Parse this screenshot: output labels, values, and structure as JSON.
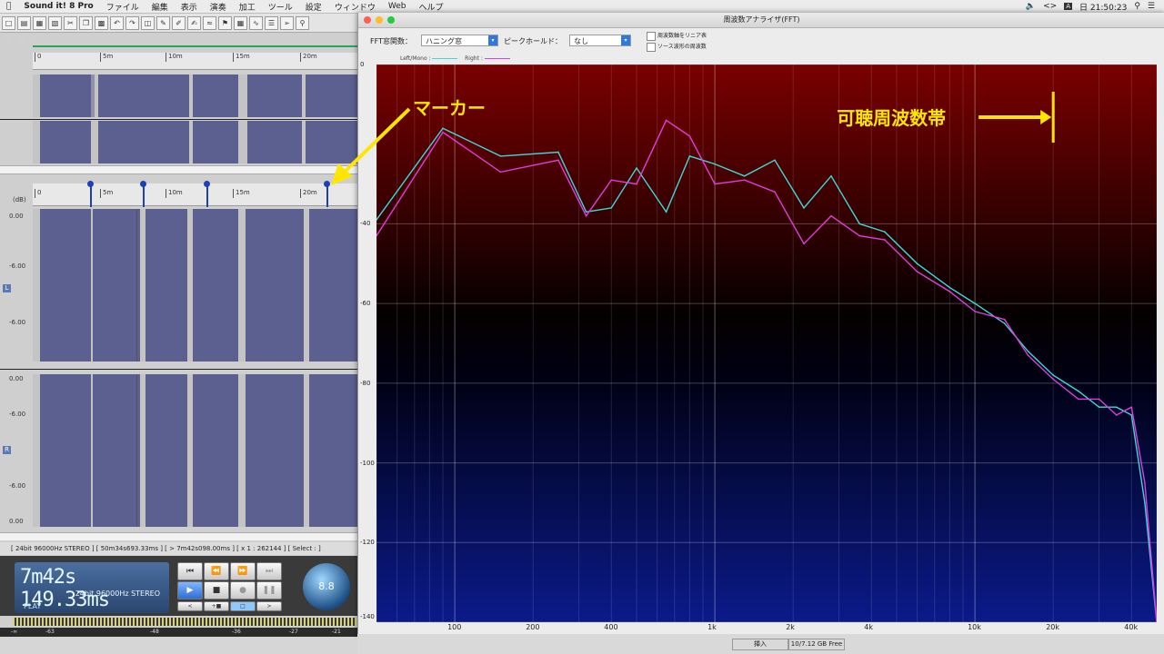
{
  "menubar": {
    "app_name": "Sound it! 8 Pro",
    "items": [
      "ファイル",
      "編集",
      "表示",
      "演奏",
      "加工",
      "ツール",
      "設定",
      "ウィンドウ",
      "Web",
      "ヘルプ"
    ],
    "clock": "日 21:50:23"
  },
  "editor": {
    "ruler_top": [
      "0",
      "5m",
      "10m",
      "15m",
      "20m"
    ],
    "ruler_main": [
      "0",
      "5m",
      "10m",
      "15m",
      "20m"
    ],
    "db_unit": "(dB)",
    "db_labels_left": [
      "0.00",
      "-6.00",
      "-6.00",
      "0.00"
    ],
    "db_labels_right": [
      "0.00",
      "-6.00",
      "-6.00",
      "0.00"
    ],
    "channel_left": "L",
    "channel_right": "R",
    "status_text": "[ 24bit  96000Hz  STEREO ]  [ 50m34s693.33ms ]  [ > 7m42s098.00ms ]  [ x 1 : 262144 ]  [ Select : ]",
    "lcd_time": "7m42s 149.33ms",
    "lcd_format": "24bit  96000Hz STEREO",
    "lcd_state": "PLAY",
    "knob_value": "8.8",
    "meter_scale": [
      "-∞",
      "-63",
      "-48",
      "-36",
      "-27",
      "-21"
    ]
  },
  "fft": {
    "title": "周波数アナライザ(FFT)",
    "window_func_label": "FFT窓関数：",
    "window_func_value": "ハニング窓",
    "peak_hold_label": "ピークホールド：",
    "peak_hold_value": "なし",
    "check_linear": "周波数軸をリニア表",
    "check_source": "ソース波形の周波数",
    "legend_left": "Left/Mono :",
    "legend_right": "Right :",
    "annotation_marker": "マーカー",
    "annotation_audible": "可聴周波数帯",
    "annotation_color": "#ffe600"
  },
  "bottom": {
    "button1": "挿入",
    "button2": "10/7.12 GB Free"
  },
  "chart_data": {
    "type": "line",
    "xscale": "log",
    "xlim": [
      50,
      50000
    ],
    "ylim": [
      -140,
      0
    ],
    "x_ticks": [
      "100",
      "200",
      "400",
      "1k",
      "2k",
      "4k",
      "10k",
      "20k",
      "40k"
    ],
    "x_tick_values": [
      100,
      200,
      400,
      1000,
      2000,
      4000,
      10000,
      20000,
      40000
    ],
    "y_ticks": [
      "0",
      "-40",
      "-60",
      "-80",
      "-100",
      "-120",
      "-140"
    ],
    "y_tick_values": [
      0,
      -40,
      -60,
      -80,
      -100,
      -120,
      -140
    ],
    "series": [
      {
        "name": "Left/Mono",
        "color": "#3fd8d8",
        "x": [
          50,
          90,
          150,
          250,
          320,
          400,
          500,
          650,
          800,
          1000,
          1300,
          1700,
          2200,
          2800,
          3600,
          4500,
          6000,
          8000,
          10000,
          13000,
          16000,
          20000,
          25000,
          30000,
          35000,
          40000,
          45000,
          50000
        ],
        "y": [
          -39,
          -16,
          -23,
          -22,
          -37,
          -36,
          -26,
          -37,
          -23,
          -25,
          -28,
          -24,
          -36,
          -28,
          -40,
          -42,
          -50,
          -56,
          -60,
          -65,
          -72,
          -78,
          -82,
          -86,
          -86,
          -88,
          -110,
          -140
        ]
      },
      {
        "name": "Right",
        "color": "#e03ce0",
        "x": [
          50,
          90,
          150,
          250,
          320,
          400,
          500,
          650,
          800,
          1000,
          1300,
          1700,
          2200,
          2800,
          3600,
          4500,
          6000,
          8000,
          10000,
          13000,
          16000,
          20000,
          25000,
          30000,
          35000,
          40000,
          45000,
          50000
        ],
        "y": [
          -43,
          -17,
          -27,
          -24,
          -38,
          -29,
          -30,
          -14,
          -18,
          -30,
          -29,
          -32,
          -45,
          -38,
          -43,
          -44,
          -52,
          -57,
          -62,
          -64,
          -73,
          -79,
          -84,
          -84,
          -88,
          -86,
          -105,
          -140
        ]
      }
    ]
  }
}
